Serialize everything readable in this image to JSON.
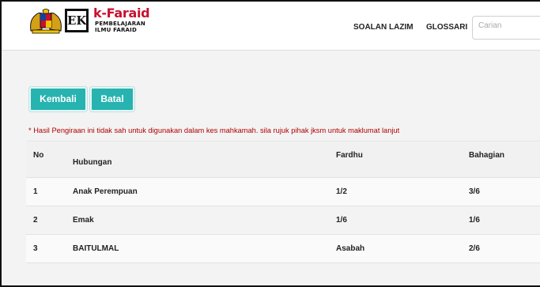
{
  "header": {
    "brand_name": "k-Faraid",
    "brand_sub_line1": "PEMBELAJARAN",
    "brand_sub_line2": "ILMU FARAID",
    "logo_text": "EK",
    "nav": {
      "soalan_lazim": "SOALAN LAZIM",
      "glossari": "GLOSSARI"
    },
    "search": {
      "placeholder": "Carian",
      "value": ""
    }
  },
  "actions": {
    "kembali_label": "Kembali",
    "batal_label": "Batal"
  },
  "disclaimer": "* Hasil Pengiraan ini tidak sah untuk digunakan dalam kes mahkamah. sila rujuk pihak jksm untuk maklumat lanjut",
  "table": {
    "headers": {
      "no": "No",
      "hubungan": "Hubungan",
      "fardhu": "Fardhu",
      "bahagian": "Bahagian"
    },
    "rows": [
      {
        "no": "1",
        "hubungan": "Anak Perempuan",
        "fardhu": "1/2",
        "bahagian": "3/6"
      },
      {
        "no": "2",
        "hubungan": "Emak",
        "fardhu": "1/6",
        "bahagian": "1/6"
      },
      {
        "no": "3",
        "hubungan": "BAITULMAL",
        "fardhu": "Asabah",
        "bahagian": "2/6"
      }
    ]
  },
  "colors": {
    "accent": "#27b3b0",
    "brand_red": "#c8102e",
    "disclaimer_red": "#b00000"
  },
  "icons": [
    "coat-of-arms-icon",
    "ek-logo-icon"
  ]
}
